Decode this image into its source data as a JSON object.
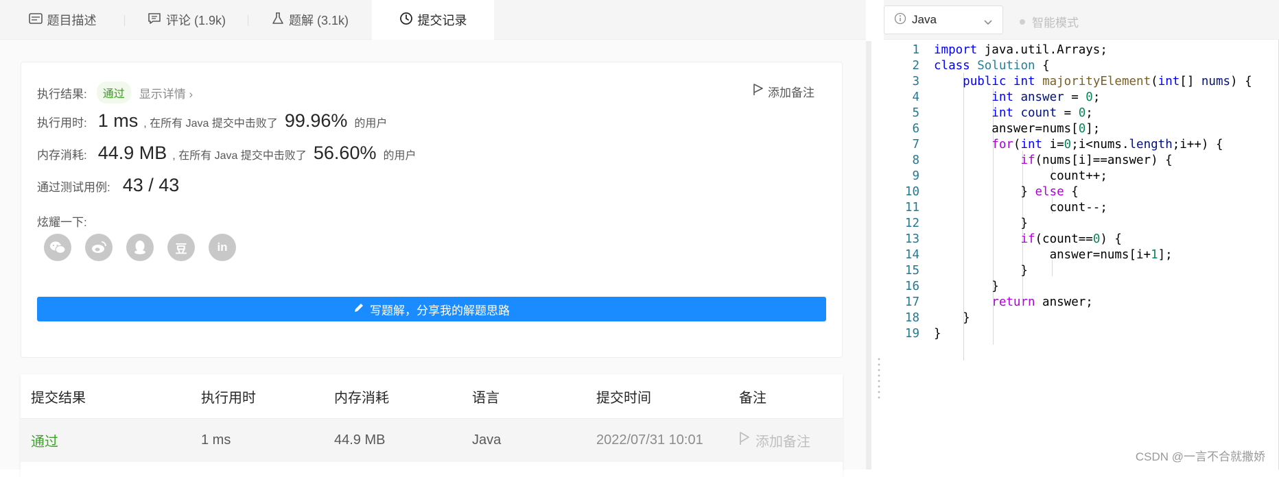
{
  "tabs": [
    {
      "label": "题目描述",
      "icon": "description-icon"
    },
    {
      "label": "评论 (1.9k)",
      "icon": "comment-icon"
    },
    {
      "label": "题解 (3.1k)",
      "icon": "flask-icon"
    },
    {
      "label": "提交记录",
      "icon": "clock-icon"
    }
  ],
  "result": {
    "status_label": "执行结果:",
    "status": "通过",
    "detail": "显示详情 ›",
    "add_note": "添加备注",
    "runtime_label": "执行用时:",
    "runtime_value": "1 ms",
    "runtime_text": ", 在所有 Java 提交中击败了",
    "runtime_percent": "99.96%",
    "runtime_suffix": "的用户",
    "memory_label": "内存消耗:",
    "memory_value": "44.9 MB",
    "memory_text": ", 在所有 Java 提交中击败了",
    "memory_percent": "56.60%",
    "memory_suffix": "的用户",
    "tests_label": "通过测试用例:",
    "tests_value": "43 / 43",
    "share_label": "炫耀一下:",
    "socials": [
      "wechat-icon",
      "weibo-icon",
      "qq-icon",
      "douban-icon",
      "linkedin-icon"
    ],
    "douban_glyph": "豆",
    "linkedin_glyph": "in",
    "write_solution": "写题解，分享我的解题思路"
  },
  "table": {
    "headers": [
      "提交结果",
      "执行用时",
      "内存消耗",
      "语言",
      "提交时间",
      "备注"
    ],
    "rows": [
      {
        "result": "通过",
        "runtime": "1 ms",
        "memory": "44.9 MB",
        "language": "Java",
        "time": "2022/07/31 10:01",
        "note": "添加备注"
      }
    ]
  },
  "editor": {
    "language": "Java",
    "smart_mode": "智能模式",
    "line_numbers": [
      "1",
      "2",
      "3",
      "4",
      "5",
      "6",
      "7",
      "8",
      "9",
      "10",
      "11",
      "12",
      "13",
      "14",
      "15",
      "16",
      "17",
      "18",
      "19"
    ]
  },
  "watermark": "CSDN @一言不合就撒娇"
}
